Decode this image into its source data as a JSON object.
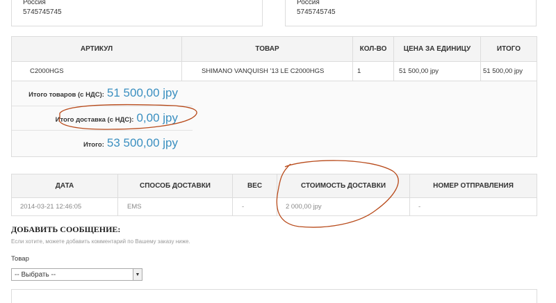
{
  "address_left": {
    "country": "Россия",
    "phone": "5745745745"
  },
  "address_right": {
    "country": "Россия",
    "phone": "5745745745"
  },
  "items_table": {
    "headers": [
      "АРТИКУЛ",
      "ТОВАР",
      "КОЛ-ВО",
      "ЦЕНА ЗА ЕДИНИЦУ",
      "ИТОГО"
    ],
    "row": {
      "sku": "C2000HGS",
      "product": "SHIMANO VANQUISH '13 LE C2000HGS",
      "qty": "1",
      "unit_price": "51 500,00 јру",
      "total": "51 500,00 јру"
    }
  },
  "totals": {
    "goods_label": "Итого товаров (с НДС):",
    "goods_value": "51 500,00 jpy",
    "delivery_label": "Итого доставка (с НДС):",
    "delivery_value": "0,00 jpy",
    "grand_label": "Итого:",
    "grand_value": "53 500,00 jpy"
  },
  "shipping_table": {
    "headers": [
      "ДАТА",
      "СПОСОБ ДОСТАВКИ",
      "ВЕС",
      "СТОИМОСТЬ ДОСТАВКИ",
      "НОМЕР ОТПРАВЛЕНИЯ"
    ],
    "row": {
      "date": "2014-03-21 12:46:05",
      "method": "EMS",
      "weight": "-",
      "cost": "2 000,00 јру",
      "tracking": "-"
    }
  },
  "message": {
    "title": "ДОБАВИТЬ СООБЩЕНИЕ:",
    "hint": "Если хотите, можете добавить комментарий по Вашему заказу ниже.",
    "product_label": "Товар",
    "select_value": "-- Выбрать --"
  },
  "colors": {
    "accent": "#3a8fc0",
    "annotation": "#b84a1a"
  }
}
